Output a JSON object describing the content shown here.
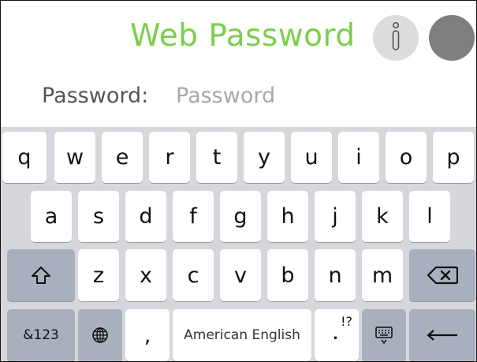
{
  "header": {
    "title": "Web Password",
    "info_icon": "info-icon",
    "circle_button": "circle-button",
    "title_color": "#7ccf4c"
  },
  "password": {
    "label": "Password:",
    "placeholder": "Password",
    "value": ""
  },
  "keyboard": {
    "row1": [
      "q",
      "w",
      "e",
      "r",
      "t",
      "y",
      "u",
      "i",
      "o",
      "p"
    ],
    "row2": [
      "a",
      "s",
      "d",
      "f",
      "g",
      "h",
      "j",
      "k",
      "l"
    ],
    "row3": [
      "z",
      "x",
      "c",
      "v",
      "b",
      "n",
      "m"
    ],
    "shift_icon": "shift-icon",
    "backspace_icon": "backspace-icon",
    "numbers_label": "&123",
    "globe_icon": "globe-icon",
    "comma": ",",
    "space_label": "American English",
    "period": ".",
    "punct_hint": "!?",
    "hide_keyboard_icon": "keyboard-hide-icon",
    "enter_icon": "enter-icon",
    "key_color": "#ffffff",
    "function_key_color": "#a9b0bd",
    "background_color": "#d6d7dc"
  }
}
